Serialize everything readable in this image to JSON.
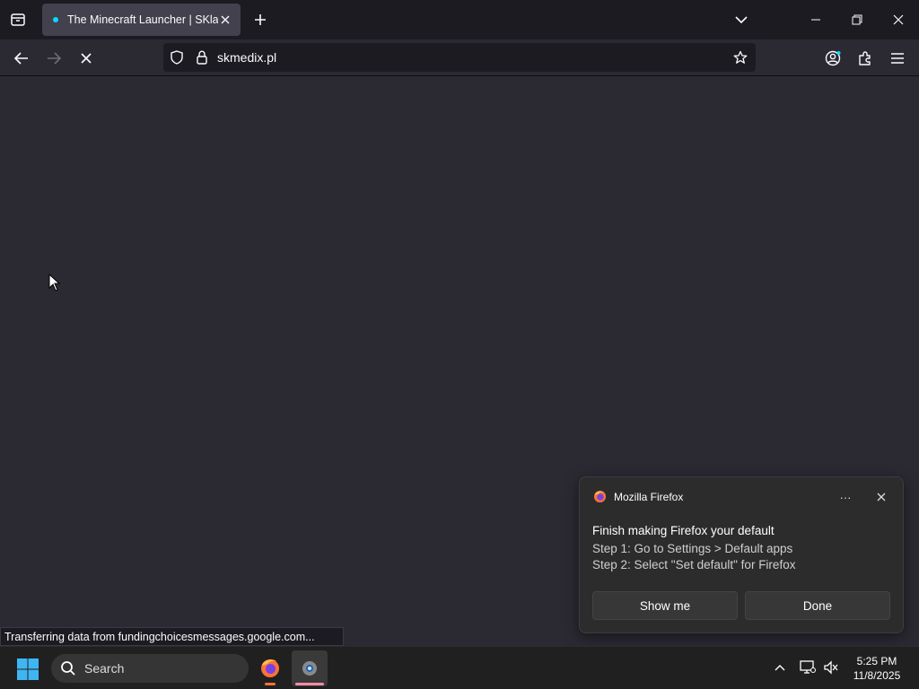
{
  "browser": {
    "tab": {
      "title": "The Minecraft Launcher | SKlauncher"
    },
    "url": "skmedix.pl",
    "status_text": "Transferring data from fundingchoicesmessages.google.com..."
  },
  "notification": {
    "app_name": "Mozilla Firefox",
    "heading": "Finish making Firefox your default",
    "step1": "Step 1: Go to Settings > Default apps",
    "step2": "Step 2: Select \"Set default\" for Firefox",
    "more_label": "···",
    "show_me_label": "Show me",
    "done_label": "Done"
  },
  "taskbar": {
    "search_label": "Search",
    "time": "5:25 PM",
    "date": "11/8/2025"
  },
  "colors": {
    "accent": "#0df",
    "firefox_orange": "#ff7139",
    "taskbar_indicator": "#f38ba8"
  }
}
